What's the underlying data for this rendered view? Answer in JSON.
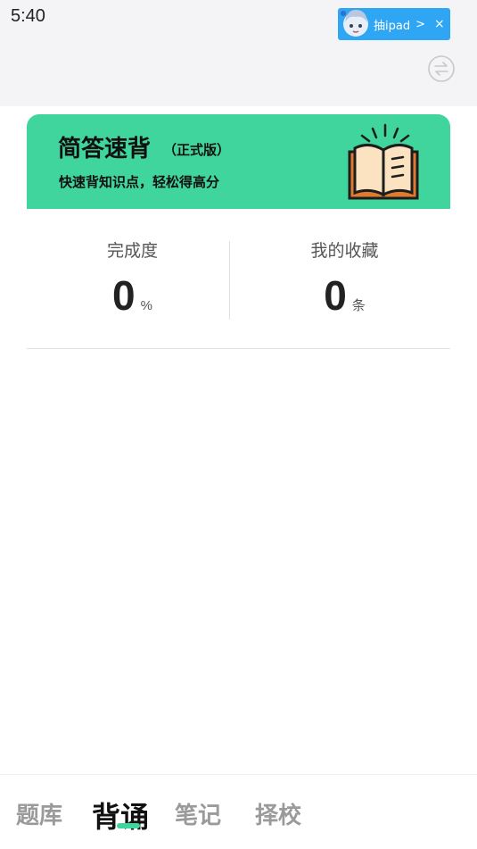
{
  "status_bar": {
    "time": "5:40"
  },
  "promo": {
    "label": "抽ipad",
    "arrow": ">",
    "close": "×"
  },
  "banner": {
    "title": "简答速背",
    "badge": "（正式版）",
    "subtitle": "快速背知识点，轻松得高分"
  },
  "stats": {
    "completion": {
      "label": "完成度",
      "value": "0",
      "unit": "%"
    },
    "favorites": {
      "label": "我的收藏",
      "value": "0",
      "unit": "条"
    }
  },
  "nav": {
    "items": [
      {
        "label": "题库"
      },
      {
        "label": "背诵"
      },
      {
        "label": "笔记"
      },
      {
        "label": "择校"
      }
    ],
    "active": "背诵",
    "accent_color": "#41d59e"
  }
}
